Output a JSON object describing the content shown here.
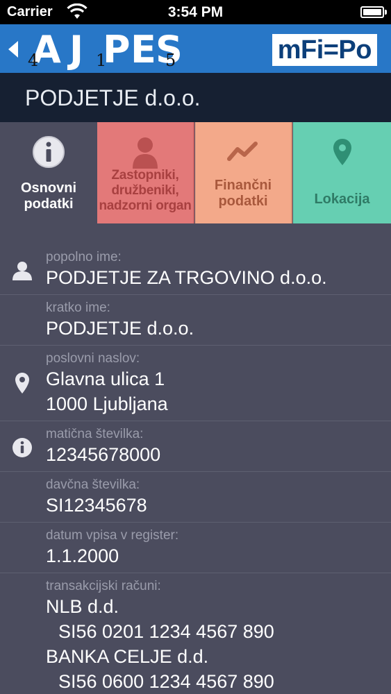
{
  "status_bar": {
    "carrier": "Carrier",
    "time": "3:54 PM"
  },
  "nav": {
    "logo_letters": [
      "A",
      "J",
      "P",
      "E",
      "S"
    ],
    "logo_numbers": [
      "4",
      "1",
      "5"
    ],
    "brand": "mFi=Po"
  },
  "company": {
    "title": "PODJETJE d.o.o."
  },
  "tabs": [
    {
      "label": "Osnovni\npodatki",
      "icon": "info-icon",
      "color": "#4b4c5e"
    },
    {
      "label": "Zastopniki,\ndružbeniki,\nnadzorni organ",
      "icon": "person-icon",
      "color": "#e37979"
    },
    {
      "label": "Finančni\npodatki",
      "icon": "trend-icon",
      "color": "#f3a98a"
    },
    {
      "label": "Lokacija",
      "icon": "location-pin-icon",
      "color": "#66cfb2"
    }
  ],
  "details": {
    "full_name": {
      "label": "popolno ime:",
      "value": "PODJETJE ZA TRGOVINO d.o.o.",
      "icon": "person-icon"
    },
    "short_name": {
      "label": "kratko ime:",
      "value": "PODJETJE d.o.o."
    },
    "address": {
      "label": "poslovni naslov:",
      "street": "Glavna ulica 1",
      "city": "1000 Ljubljana",
      "icon": "location-pin-icon"
    },
    "reg_number": {
      "label": "matična številka:",
      "value": "12345678000",
      "icon": "info-icon"
    },
    "tax_number": {
      "label": "davčna številka:",
      "value": "SI12345678"
    },
    "reg_date": {
      "label": "datum vpisa v register:",
      "value": "1.1.2000"
    },
    "accounts": {
      "label": "transakcijski računi:",
      "items": [
        {
          "bank": "NLB d.d.",
          "iban": "SI56 0201 1234 4567 890"
        },
        {
          "bank": "BANKA CELJE d.d.",
          "iban": "SI56 0600 1234 4567 890"
        }
      ]
    }
  }
}
